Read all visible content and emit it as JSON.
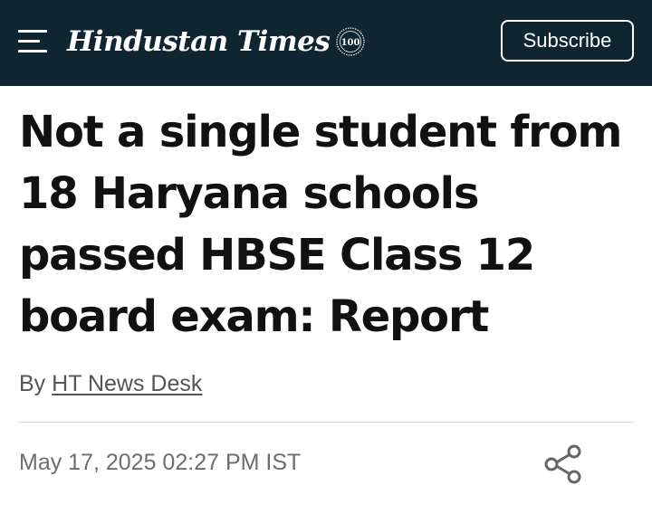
{
  "header": {
    "logo_text": "Hindustan Times",
    "seal_text": "100",
    "subscribe_label": "Subscribe",
    "background_color": "#0f2632"
  },
  "article": {
    "headline_lines": [
      "Not a single student from",
      "18 Haryana schools",
      "passed HBSE Class 12",
      "board exam: Report"
    ],
    "byline_prefix": "By",
    "author": "HT News Desk",
    "timestamp": "May 17, 2025 02:27 PM IST"
  },
  "icons": {
    "menu": "hamburger-menu-icon",
    "seal": "centenary-seal-icon",
    "share": "share-icon"
  }
}
